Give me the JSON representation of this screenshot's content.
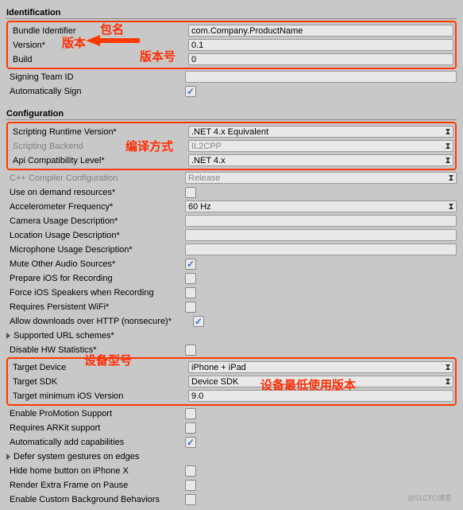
{
  "identification": {
    "title": "Identification",
    "bundle": {
      "label": "Bundle Identifier",
      "value": "com.Company.ProductName"
    },
    "version": {
      "label": "Version*",
      "value": "0.1"
    },
    "build": {
      "label": "Build",
      "value": "0"
    },
    "signingTeam": {
      "label": "Signing Team ID",
      "value": ""
    },
    "autoSign": {
      "label": "Automatically Sign",
      "checked": true
    }
  },
  "configuration": {
    "title": "Configuration",
    "scriptingRuntime": {
      "label": "Scripting Runtime Version*",
      "value": ".NET 4.x Equivalent"
    },
    "scriptingBackend": {
      "label": "Scripting Backend",
      "value": "IL2CPP"
    },
    "apiCompat": {
      "label": "Api Compatibility Level*",
      "value": ".NET 4.x"
    },
    "cppConfig": {
      "label": "C++ Compiler Configuration",
      "value": "Release"
    },
    "onDemand": {
      "label": "Use on demand resources*",
      "checked": false
    },
    "accelFreq": {
      "label": "Accelerometer Frequency*",
      "value": "60 Hz"
    },
    "cameraDesc": {
      "label": "Camera Usage Description*",
      "value": ""
    },
    "locationDesc": {
      "label": "Location Usage Description*",
      "value": ""
    },
    "micDesc": {
      "label": "Microphone Usage Description*",
      "value": ""
    },
    "muteAudio": {
      "label": "Mute Other Audio Sources*",
      "checked": true
    },
    "prepareRecording": {
      "label": "Prepare iOS for Recording",
      "checked": false
    },
    "forceSpeakers": {
      "label": "Force iOS Speakers when Recording",
      "checked": false
    },
    "persistWifi": {
      "label": "Requires Persistent WiFi*",
      "checked": false
    },
    "allowHttp": {
      "label": "Allow downloads over HTTP (nonsecure)*",
      "checked": true
    },
    "urlSchemes": {
      "label": "Supported URL schemes*"
    },
    "disableHW": {
      "label": "Disable HW Statistics*",
      "checked": false
    },
    "targetDevice": {
      "label": "Target Device",
      "value": "iPhone + iPad"
    },
    "targetSDK": {
      "label": "Target SDK",
      "value": "Device SDK"
    },
    "targetMinIOS": {
      "label": "Target minimum iOS Version",
      "value": "9.0"
    },
    "proMotion": {
      "label": "Enable ProMotion Support",
      "checked": false
    },
    "arkit": {
      "label": "Requires ARKit support",
      "checked": false
    },
    "autoCap": {
      "label": "Automatically add capabilities",
      "checked": true
    },
    "deferGestures": {
      "label": "Defer system gestures on edges"
    },
    "hideHome": {
      "label": "Hide home button on iPhone X",
      "checked": false
    },
    "extraFrame": {
      "label": "Render Extra Frame on Pause",
      "checked": false
    },
    "customBg": {
      "label": "Enable Custom Background Behaviors",
      "checked": false
    }
  },
  "annotations": {
    "bundleName": "包名",
    "version": "版本",
    "versionNumber": "版本号",
    "compileMethod": "编译方式",
    "deviceModel": "设备型号",
    "minDeviceVersion": "设备最低使用版本"
  },
  "watermark": "@51CTO博客"
}
